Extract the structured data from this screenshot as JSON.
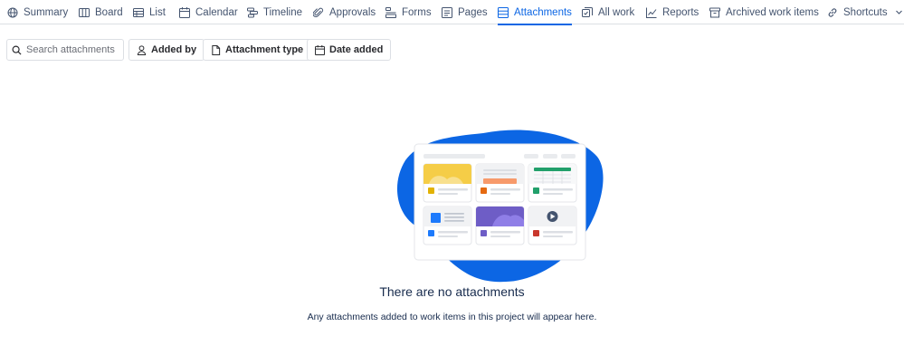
{
  "tabs": [
    {
      "label": "Summary",
      "icon": "globe-icon"
    },
    {
      "label": "Board",
      "icon": "board-icon"
    },
    {
      "label": "List",
      "icon": "list-icon"
    },
    {
      "label": "Calendar",
      "icon": "calendar-icon"
    },
    {
      "label": "Timeline",
      "icon": "timeline-icon"
    },
    {
      "label": "Approvals",
      "icon": "paperclip-icon"
    },
    {
      "label": "Forms",
      "icon": "forms-icon"
    },
    {
      "label": "Pages",
      "icon": "page-icon"
    },
    {
      "label": "Attachments",
      "icon": "attachments-icon",
      "active": true
    },
    {
      "label": "All work",
      "icon": "all-work-icon"
    },
    {
      "label": "Reports",
      "icon": "reports-icon"
    },
    {
      "label": "Archived work items",
      "icon": "archive-icon"
    },
    {
      "label": "Shortcuts",
      "icon": "link-icon"
    }
  ],
  "filters": {
    "search_placeholder": "Search attachments",
    "added_by": "Added by",
    "attachment_type": "Attachment type",
    "date_added": "Date added"
  },
  "empty_state": {
    "title": "There are no attachments",
    "description": "Any attachments added to work items in this project will appear here."
  },
  "colors": {
    "accent": "#0c66e4",
    "blob": "#0c66e4",
    "text": "#292a2e",
    "muted": "#44546f"
  }
}
